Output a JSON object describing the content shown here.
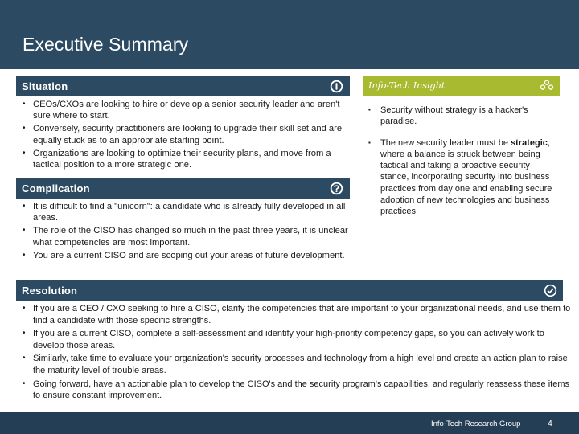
{
  "header": {
    "title": "Executive Summary"
  },
  "situation": {
    "title": "Situation",
    "icon": "info-icon",
    "bullets": [
      "CEOs/CXOs are looking to hire or develop a senior security leader and aren't sure where to start.",
      "Conversely, security practitioners are looking to upgrade their skill set and are equally stuck as to an appropriate starting point.",
      "Organizations are looking to optimize their security plans, and move from a tactical position to a more strategic one."
    ]
  },
  "complication": {
    "title": "Complication",
    "icon": "question-icon",
    "bullets": [
      "It is difficult to find a \"unicorn\": a candidate who is already fully developed in all areas.",
      "The role of the CISO has changed so much in the past three years, it is unclear what competencies are most important.",
      "You are a current CISO and are scoping out your areas of future development."
    ]
  },
  "insight": {
    "title": "Info-Tech Insight",
    "icon": "gears-icon",
    "bullet1": "Security without strategy is a hacker's paradise.",
    "bullet2_prefix": "The new security leader must be ",
    "bullet2_bold": "strategic",
    "bullet2_suffix": ", where a balance is struck between being tactical and taking a proactive security stance, incorporating security into business practices from day one and enabling secure adoption of new technologies and business practices."
  },
  "resolution": {
    "title": "Resolution",
    "icon": "check-circle-icon",
    "bullets": [
      "If you are a CEO / CXO seeking to hire a CISO, clarify the competencies that are important to your organizational needs, and use them to find a candidate with those specific strengths.",
      "If you are a current CISO, complete a self-assessment and identify your high-priority competency gaps, so you can actively work to develop those areas.",
      "Similarly, take time to evaluate your organization's security processes and technology from a high level and create an action plan to raise the maturity level of trouble areas.",
      "Going forward, have an actionable plan to develop the CISO's and the security program's capabilities, and regularly reassess these items to ensure constant improvement."
    ]
  },
  "footer": {
    "organization": "Info-Tech Research Group",
    "page_number": "4"
  },
  "colors": {
    "navy": "#2c4a61",
    "footer_navy": "#243f55",
    "insight_green": "#a8ba2f"
  }
}
